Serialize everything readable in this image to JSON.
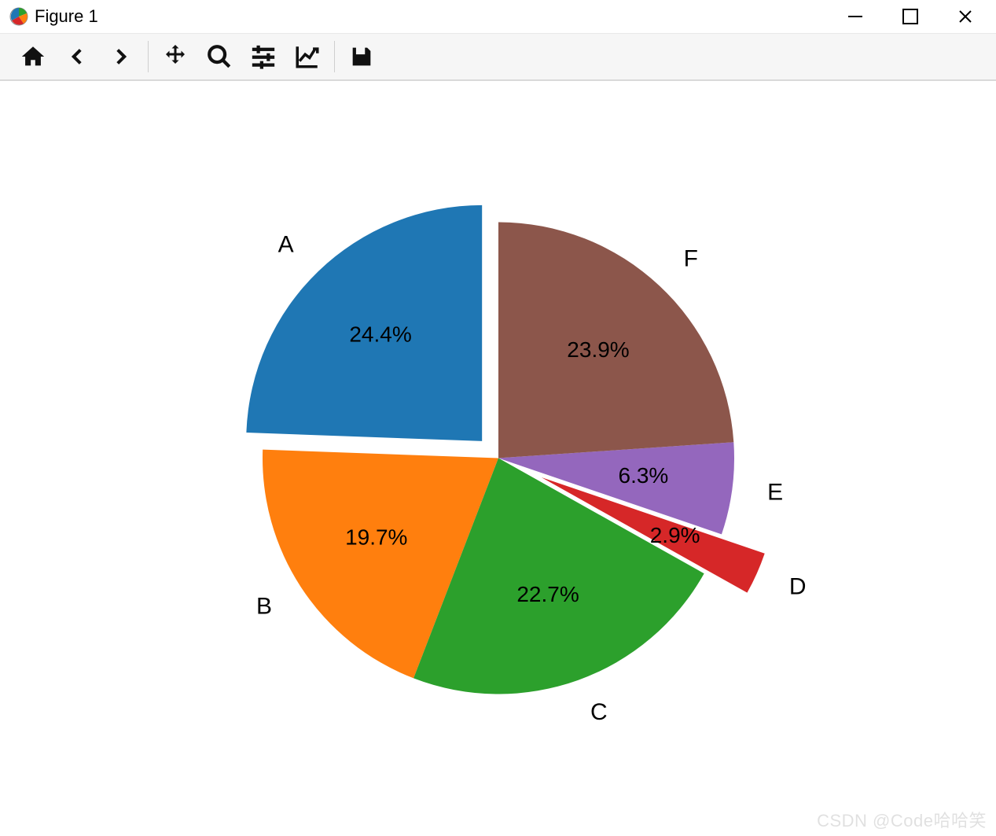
{
  "window": {
    "title": "Figure 1"
  },
  "toolbar": {
    "home": "Home",
    "back": "Back",
    "forward": "Forward",
    "pan": "Pan",
    "zoom": "Zoom",
    "subplots": "Configure subplots",
    "axes": "Edit axis",
    "save": "Save"
  },
  "watermark": "CSDN @Code哈哈笑",
  "chart_data": {
    "type": "pie",
    "categories": [
      "A",
      "B",
      "C",
      "D",
      "E",
      "F"
    ],
    "values": [
      24.4,
      19.7,
      22.7,
      2.9,
      6.3,
      23.9
    ],
    "pct_labels": [
      "24.4%",
      "19.7%",
      "22.7%",
      "2.9%",
      "6.3%",
      "23.9%"
    ],
    "colors": [
      "#1f77b4",
      "#ff7f0e",
      "#2ca02c",
      "#d62728",
      "#9467bd",
      "#8c564b"
    ],
    "explode": [
      0.1,
      0,
      0,
      0.2,
      0,
      0
    ],
    "startangle": 90,
    "counterclockwise": true,
    "radius": 300,
    "title": "",
    "legend": null
  }
}
